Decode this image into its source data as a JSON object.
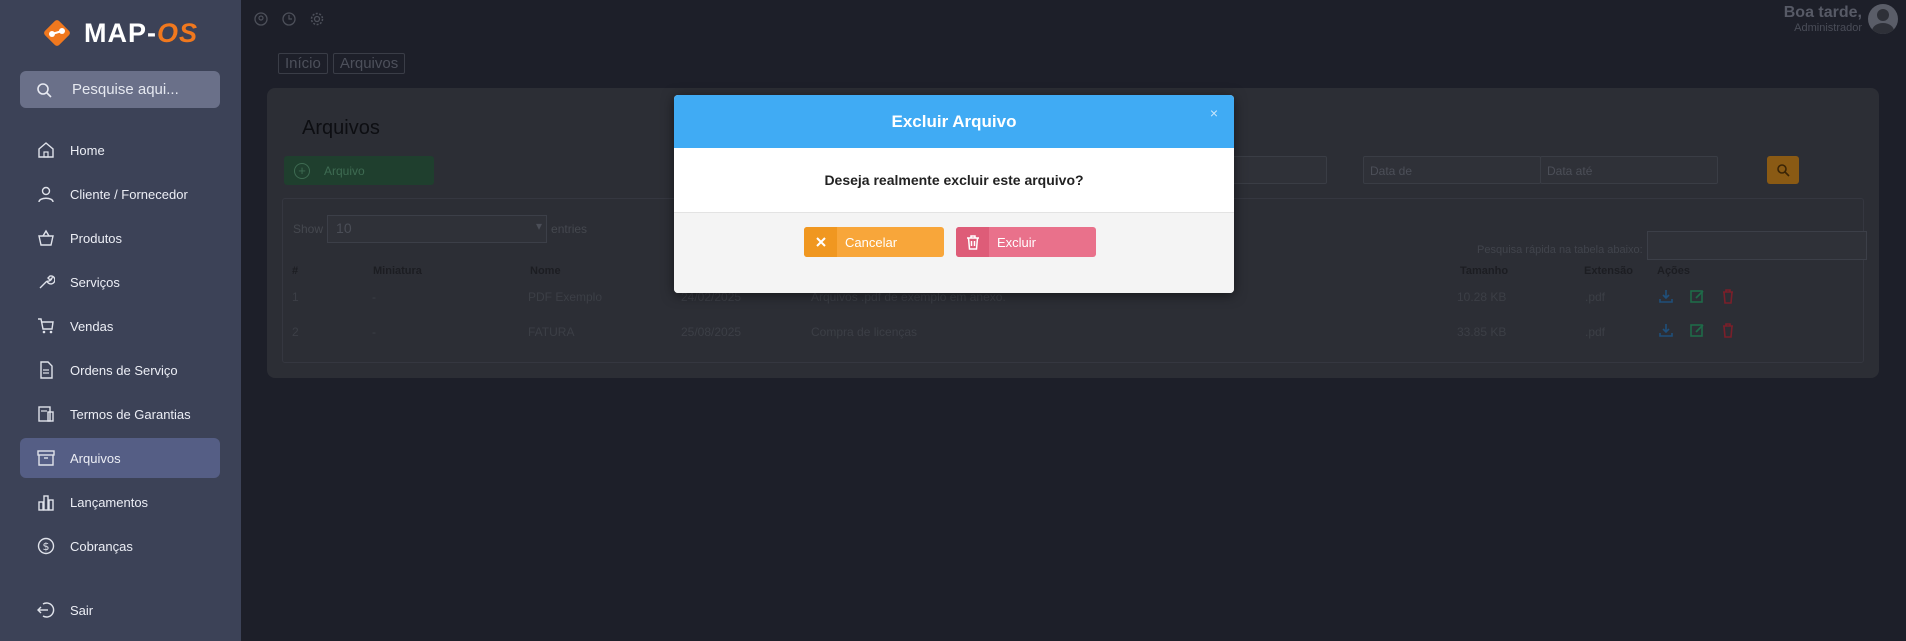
{
  "app": {
    "logo_main": "MAP-",
    "logo_accent": "OS"
  },
  "sidebar": {
    "search_placeholder": "Pesquise aqui...",
    "items": [
      {
        "label": "Home",
        "icon": "home-icon"
      },
      {
        "label": "Cliente / Fornecedor",
        "icon": "user-icon"
      },
      {
        "label": "Produtos",
        "icon": "basket-icon"
      },
      {
        "label": "Serviços",
        "icon": "wrench-icon"
      },
      {
        "label": "Vendas",
        "icon": "cart-icon"
      },
      {
        "label": "Ordens de Serviço",
        "icon": "document-icon"
      },
      {
        "label": "Termos de Garantias",
        "icon": "receipt-icon"
      },
      {
        "label": "Arquivos",
        "icon": "archive-icon",
        "active": true
      },
      {
        "label": "Lançamentos",
        "icon": "chart-icon"
      },
      {
        "label": "Cobranças",
        "icon": "dollar-icon"
      }
    ],
    "exit_label": "Sair"
  },
  "topbar": {
    "greeting": "Boa tarde,",
    "role": "Administrador"
  },
  "breadcrumb": [
    "Início",
    "Arquivos"
  ],
  "page": {
    "title": "Arquivos",
    "add_button": "Arquivo",
    "date_from_placeholder": "Data de",
    "date_to_placeholder": "Data até",
    "show_label": "Show",
    "show_value": "10",
    "entries_label": "entries",
    "quick_search_label": "Pesquisa rápida na tabela abaixo:"
  },
  "table": {
    "headers": {
      "num": "#",
      "thumb": "Miniatura",
      "name": "Nome",
      "size": "Tamanho",
      "ext": "Extensão",
      "actions": "Ações"
    },
    "rows": [
      {
        "num": "1",
        "thumb": "-",
        "name": "PDF Exemplo",
        "date": "24/02/2025",
        "desc": "Arquivos .pdf de exemplo em anexo.",
        "size": "10.28 KB",
        "ext": ".pdf"
      },
      {
        "num": "2",
        "thumb": "-",
        "name": "FATURA",
        "date": "25/08/2025",
        "desc": "Compra de licenças",
        "size": "33.85 KB",
        "ext": ".pdf"
      }
    ]
  },
  "modal": {
    "title": "Excluir Arquivo",
    "close": "×",
    "message": "Deseja realmente excluir este arquivo?",
    "cancel_label": "Cancelar",
    "delete_label": "Excluir"
  },
  "colors": {
    "sidebar_bg": "#3c4257",
    "modal_header": "#40abf4",
    "cancel": "#f8a63a",
    "delete": "#e9718b",
    "brand_accent": "#f0781e"
  }
}
